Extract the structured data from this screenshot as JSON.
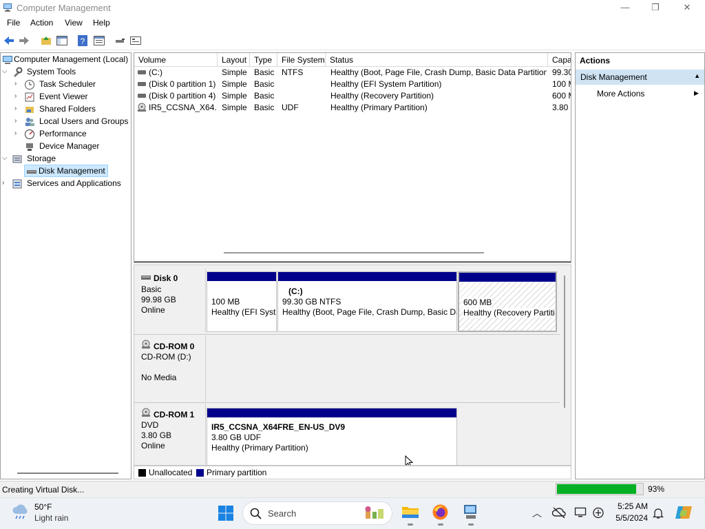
{
  "window": {
    "title": "Computer Management",
    "controls": [
      "—",
      "❐",
      "✕"
    ]
  },
  "menu": [
    "File",
    "Action",
    "View",
    "Help"
  ],
  "toolbar_icons": [
    "back-arrow-icon",
    "forward-arrow-icon",
    "up-folder-icon",
    "show-hide-tree-icon",
    "help-icon",
    "properties-icon",
    "connect-icon",
    "console-icon"
  ],
  "tree": {
    "root": "Computer Management (Local)",
    "system_tools": "System Tools",
    "task_scheduler": "Task Scheduler",
    "event_viewer": "Event Viewer",
    "shared_folders": "Shared Folders",
    "local_users": "Local Users and Groups",
    "performance": "Performance",
    "device_manager": "Device Manager",
    "storage": "Storage",
    "disk_management": "Disk Management",
    "services": "Services and Applications"
  },
  "volumes": {
    "columns": [
      "Volume",
      "Layout",
      "Type",
      "File System",
      "Status",
      "Capa"
    ],
    "rows": [
      {
        "volume": "(C:)",
        "layout": "Simple",
        "type": "Basic",
        "fs": "NTFS",
        "status": "Healthy (Boot, Page File, Crash Dump, Basic Data Partition)",
        "capacity": "99.30"
      },
      {
        "volume": "(Disk 0 partition 1)",
        "layout": "Simple",
        "type": "Basic",
        "fs": "",
        "status": "Healthy (EFI System Partition)",
        "capacity": "100 M"
      },
      {
        "volume": "(Disk 0 partition 4)",
        "layout": "Simple",
        "type": "Basic",
        "fs": "",
        "status": "Healthy (Recovery Partition)",
        "capacity": "600 M"
      },
      {
        "volume": "IR5_CCSNA_X64...",
        "layout": "Simple",
        "type": "Basic",
        "fs": "UDF",
        "status": "Healthy (Primary Partition)",
        "capacity": "3.80 C"
      }
    ]
  },
  "disks": {
    "disk0": {
      "name": "Disk 0",
      "type": "Basic",
      "size": "99.98 GB",
      "state": "Online",
      "partitions": [
        {
          "size": "100 MB",
          "status": "Healthy (EFI Syst"
        },
        {
          "label": "(C:)",
          "size": "99.30 GB NTFS",
          "status": "Healthy (Boot, Page File, Crash Dump, Basic Da"
        },
        {
          "size": "600 MB",
          "status": "Healthy (Recovery Partiti"
        }
      ]
    },
    "cdrom0": {
      "name": "CD-ROM 0",
      "type": "CD-ROM (D:)",
      "state": "No Media"
    },
    "cdrom1": {
      "name": "CD-ROM 1",
      "type": "DVD",
      "size": "3.80 GB",
      "state": "Online",
      "partition": {
        "label": "IR5_CCSNA_X64FRE_EN-US_DV9",
        "size": "3.80 GB UDF",
        "status": "Healthy (Primary Partition)"
      }
    }
  },
  "legend": {
    "unallocated": "Unallocated",
    "primary": "Primary partition",
    "colors": {
      "unallocated": "#000000",
      "primary": "#00008b"
    }
  },
  "actions": {
    "header": "Actions",
    "section": "Disk Management",
    "more": "More Actions"
  },
  "status": {
    "text": "Creating Virtual Disk...",
    "progress_pct": 93,
    "progress_label": "93%"
  },
  "taskbar": {
    "weather_temp": "50°F",
    "weather_desc": "Light rain",
    "search_placeholder": "Search",
    "time": "5:25 AM",
    "date": "5/5/2024"
  }
}
